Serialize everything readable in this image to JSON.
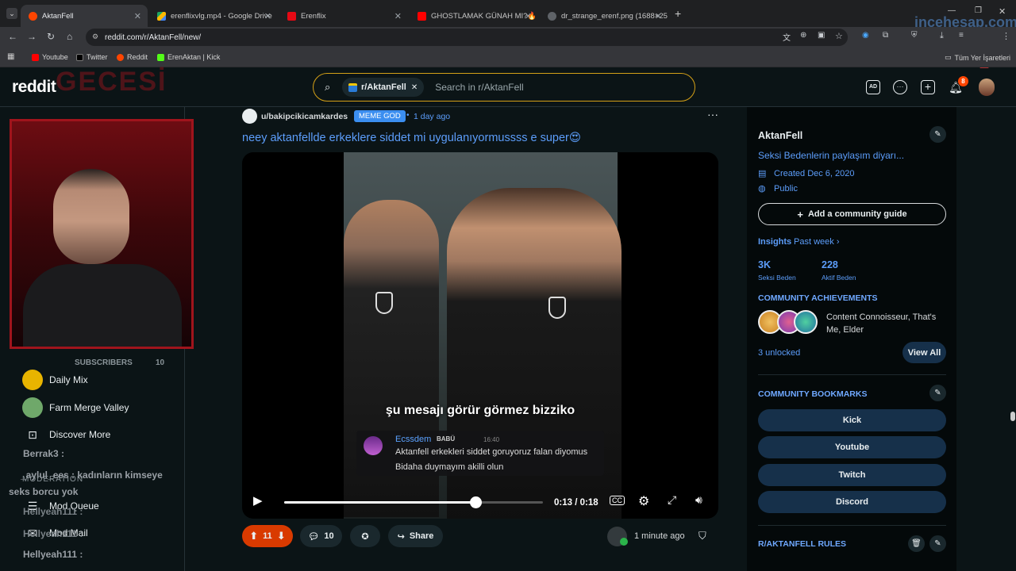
{
  "browser": {
    "tabs": [
      {
        "label": "AktanFell",
        "color": "#ff4500",
        "active": true
      },
      {
        "label": "erenflixvlg.mp4 - Google Drive",
        "color": "#1ea362"
      },
      {
        "label": "Erenflix",
        "color": "#e50914"
      },
      {
        "label": "GHOSTLAMAK GÜNAH MI?🔥",
        "color": "#ff0000"
      },
      {
        "label": "dr_strange_erenf.png (1688×25",
        "color": "#5f6368"
      }
    ],
    "url": "reddit.com/r/AktanFell/new/",
    "bookmarks": [
      {
        "label": "Youtube",
        "color": "#ff0000"
      },
      {
        "label": "Twitter",
        "color": "#000000"
      },
      {
        "label": "Reddit",
        "color": "#ff4500"
      },
      {
        "label": "ErenAktan | Kick",
        "color": "#53fc18"
      }
    ],
    "all_bookmarks_label": "Tüm Yer İşaretleri",
    "watermark": "incehesap.com"
  },
  "reddit": {
    "logo": "reddit",
    "search_chip": "r/AktanFell",
    "search_placeholder": "Search in r/AktanFell",
    "notification_count": "8"
  },
  "leftnav": {
    "subscribers_label": "SUBSCRIBERS",
    "subscribers_count": "10",
    "items": [
      {
        "label": "Daily Mix"
      },
      {
        "label": "Farm Merge Valley"
      },
      {
        "label": "Discover More"
      }
    ],
    "moderation_label": "MODERATION",
    "mod_items": [
      {
        "label": "Mod Queue"
      },
      {
        "label": "Mod Mail"
      }
    ],
    "chat_lines": [
      {
        "text": "Berrak3 :"
      },
      {
        "text": "_aylul_ees : kadınların kimseye"
      },
      {
        "text": "seks borcu yok"
      },
      {
        "text": "Hellyeah111 :"
      },
      {
        "text": "Hellyeah111 :"
      },
      {
        "text": "Hellyeah111 :"
      }
    ],
    "overlay_text": "GECESİ"
  },
  "post": {
    "author": "u/bakipcikicamkardes",
    "flair": "MEME GOD",
    "time": "1 day ago",
    "title": "neey aktanfellde erkeklere siddet mi uygulanıyormussss e super😍",
    "subtitle": "şu mesajı görür görmez bizziko",
    "chat_user": "Ecssdem",
    "chat_badge": "BABÜ",
    "chat_time": "16:40",
    "chat_msg_1": "Aktanfell erkekleri siddet goruyoruz falan diyomus",
    "chat_msg_2": "Bidaha duymayım akilli olun",
    "video_time": "0:13 / 0:18",
    "progress": 0.74,
    "votes": "11",
    "comments": "10",
    "share_label": "Share",
    "comment_time": "1 minute ago"
  },
  "sidebar": {
    "name": "AktanFell",
    "description": "Seksi Bedenlerin paylaşım diyarı...",
    "created": "Created Dec 6, 2020",
    "visibility": "Public",
    "guide_button": "Add a community guide",
    "insights_label": "Insights",
    "insights_period": "Past week",
    "stat1_value": "3K",
    "stat1_label": "Seksi Beden",
    "stat2_value": "228",
    "stat2_label": "Aktif Beden",
    "achievements_label": "COMMUNITY ACHIEVEMENTS",
    "achievements_text": "Content Connoisseur, That's Me, Elder",
    "unlocked": "3 unlocked",
    "view_all": "View All",
    "bookmarks_label": "COMMUNITY BOOKMARKS",
    "bookmarks": [
      {
        "label": "Kick"
      },
      {
        "label": "Youtube"
      },
      {
        "label": "Twitch"
      },
      {
        "label": "Discord"
      }
    ],
    "rules_label": "R/AKTANFELL RULES"
  }
}
